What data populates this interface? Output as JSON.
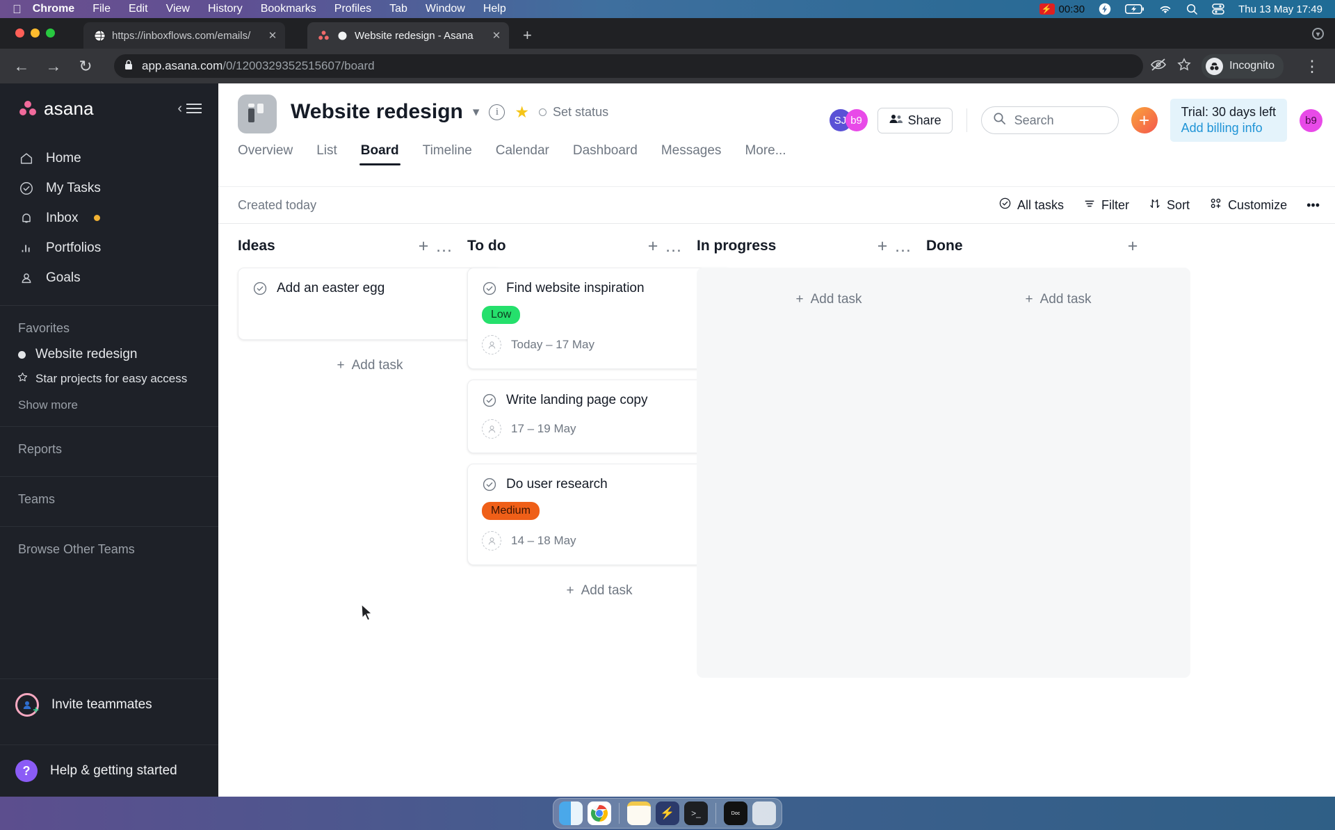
{
  "menubar": {
    "apple_icon": "apple-icon",
    "items": [
      "Chrome",
      "File",
      "Edit",
      "View",
      "History",
      "Bookmarks",
      "Profiles",
      "Tab",
      "Window",
      "Help"
    ],
    "active_app": "Chrome",
    "recording_timer": "00:30",
    "status_icons": [
      "bolt-icon",
      "battery-charging-icon",
      "wifi-icon",
      "search-icon",
      "control-center-icon"
    ],
    "clock": "Thu 13 May  17:49",
    "date": "Thu 13 May",
    "time": "17:49"
  },
  "browser": {
    "tabs": [
      {
        "title": "https://inboxflows.com/emails/",
        "favicon": "globe-icon",
        "active": false
      },
      {
        "title": "Website redesign - Asana",
        "favicon": "asana-icon",
        "active": true
      }
    ],
    "new_tab_label": "+",
    "back_icon": "back-arrow-icon",
    "forward_icon": "forward-arrow-icon",
    "reload_icon": "reload-icon",
    "url_host": "app.asana.com",
    "url_path": "/0/1200329352515607/board",
    "lock_icon": "lock-icon",
    "profile_label": "Incognito",
    "menu_icon": "three-dot-menu-icon"
  },
  "sidebar": {
    "brand": "asana",
    "collapse_icon": "collapse-sidebar-icon",
    "nav": [
      {
        "label": "Home",
        "icon": "home-icon"
      },
      {
        "label": "My Tasks",
        "icon": "check-circle-icon"
      },
      {
        "label": "Inbox",
        "icon": "bell-icon",
        "badge": true
      },
      {
        "label": "Portfolios",
        "icon": "bar-chart-icon"
      },
      {
        "label": "Goals",
        "icon": "goal-person-icon"
      }
    ],
    "favorites_label": "Favorites",
    "favorite_project": "Website redesign",
    "star_hint": "Star projects for easy access",
    "show_more": "Show more",
    "reports_label": "Reports",
    "teams_label": "Teams",
    "browse_teams_label": "Browse Other Teams",
    "invite_label": "Invite teammates",
    "help_label": "Help & getting started"
  },
  "project": {
    "title": "Website redesign",
    "status_label": "Set status",
    "tabs": [
      "Overview",
      "List",
      "Board",
      "Timeline",
      "Calendar",
      "Dashboard",
      "Messages",
      "More..."
    ],
    "active_tab": "Board",
    "members": [
      {
        "initials": "SJ",
        "color": "#5a51d6"
      },
      {
        "initials": "b9",
        "color": "#e84ae8"
      }
    ],
    "share_label": "Share",
    "search_placeholder": "Search",
    "create_label": "+",
    "trial_line1": "Trial: 30 days left",
    "trial_line2": "Add billing info",
    "account_initials": "b9"
  },
  "toolbar": {
    "created": "Created today",
    "all_tasks": "All tasks",
    "filter": "Filter",
    "sort": "Sort",
    "customize": "Customize",
    "overflow": "•••"
  },
  "board": {
    "add_task_label": "Add task",
    "columns": [
      {
        "name": "Ideas",
        "has_more_menu": true,
        "cards": [
          {
            "title": "Add an easter egg",
            "tag": null,
            "tag_kind": null,
            "due": null
          }
        ]
      },
      {
        "name": "To do",
        "has_more_menu": true,
        "cards": [
          {
            "title": "Find website inspiration",
            "tag": "Low",
            "tag_kind": "low",
            "due": "Today – 17 May"
          },
          {
            "title": "Write landing page copy",
            "tag": null,
            "tag_kind": null,
            "due": "17 – 19 May"
          },
          {
            "title": "Do user research",
            "tag": "Medium",
            "tag_kind": "medium",
            "due": "14 – 18 May"
          }
        ]
      },
      {
        "name": "In progress",
        "has_more_menu": true,
        "cards": []
      },
      {
        "name": "Done",
        "has_more_menu": false,
        "cards": []
      }
    ]
  },
  "colors": {
    "tag_low": "#25e06c",
    "tag_medium": "#ef5f18",
    "brand_pink": "#f06a9b",
    "accent_blue": "#2094d6",
    "sidebar_bg": "#1e2128"
  },
  "dock": {
    "items": [
      "finder-icon",
      "chrome-icon",
      "notes-icon",
      "thunder-icon",
      "terminal-icon",
      "doc-icon",
      "trash-icon"
    ]
  }
}
